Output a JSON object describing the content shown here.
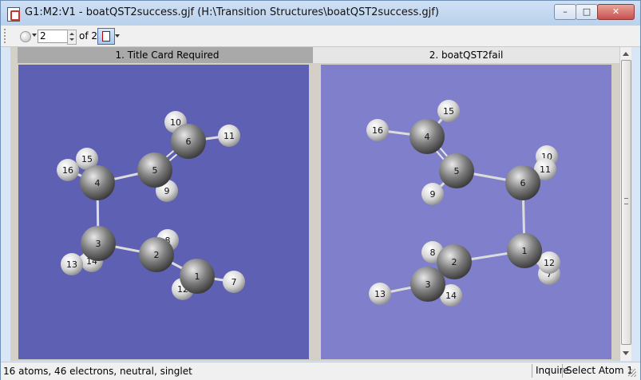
{
  "window": {
    "title": "G1:M2:V1 - boatQST2success.gjf (H:\\Transition Structures\\boatQST2success.gjf)",
    "minimize_symbol": "–",
    "maximize_symbol": "□",
    "close_symbol": "✕"
  },
  "toolbar": {
    "icons": [
      "circle-icon",
      "dropdown-arrow-icon",
      "molecule-view-icon"
    ],
    "spin_value": "2",
    "of_label": "of",
    "total": "2"
  },
  "panels": [
    {
      "header": "1.  Title Card Required",
      "bg_color": "#5e60b3",
      "atoms": [
        {
          "label": "1",
          "element": "C"
        },
        {
          "label": "2",
          "element": "C"
        },
        {
          "label": "3",
          "element": "C"
        },
        {
          "label": "4",
          "element": "C"
        },
        {
          "label": "5",
          "element": "C"
        },
        {
          "label": "6",
          "element": "C"
        },
        {
          "label": "7",
          "element": "H"
        },
        {
          "label": "8",
          "element": "H"
        },
        {
          "label": "9",
          "element": "H"
        },
        {
          "label": "10",
          "element": "H"
        },
        {
          "label": "11",
          "element": "H"
        },
        {
          "label": "12",
          "element": "H"
        },
        {
          "label": "14",
          "element": "H"
        },
        {
          "label": "15",
          "element": "H"
        },
        {
          "label": "16",
          "element": "H"
        },
        {
          "label": "13",
          "element": "H"
        }
      ]
    },
    {
      "header": "2.  boatQST2fail",
      "bg_color": "#7f7fcc",
      "atoms": [
        {
          "label": "1",
          "element": "C"
        },
        {
          "label": "2",
          "element": "C"
        },
        {
          "label": "3",
          "element": "C"
        },
        {
          "label": "4",
          "element": "C"
        },
        {
          "label": "5",
          "element": "C"
        },
        {
          "label": "6",
          "element": "C"
        },
        {
          "label": "7",
          "element": "H"
        },
        {
          "label": "8",
          "element": "H"
        },
        {
          "label": "9",
          "element": "H"
        },
        {
          "label": "10",
          "element": "H"
        },
        {
          "label": "11",
          "element": "H"
        },
        {
          "label": "12",
          "element": "H"
        },
        {
          "label": "13",
          "element": "H"
        },
        {
          "label": "14",
          "element": "H"
        },
        {
          "label": "15",
          "element": "H"
        },
        {
          "label": "16",
          "element": "H"
        }
      ]
    }
  ],
  "status": {
    "info": "16 atoms, 46 electrons, neutral, singlet",
    "mode": "Inquire",
    "action": "Select Atom 1"
  }
}
